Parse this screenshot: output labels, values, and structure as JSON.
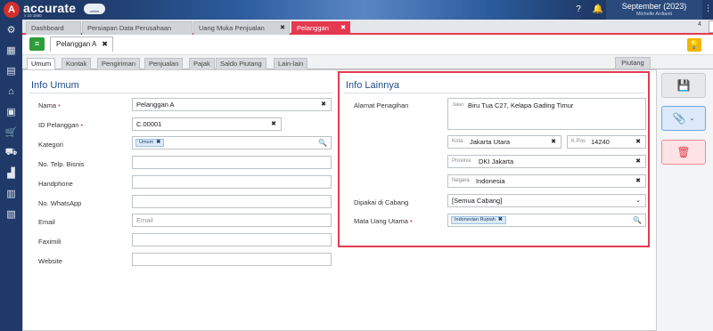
{
  "app": {
    "brand": "accurate",
    "version": "v 10.1900",
    "online_label": "online",
    "period": "September (2023)",
    "user": "Michelle Ardianti",
    "menu_glyph": "⋮"
  },
  "icons": {
    "help": "?",
    "bell": "🔔",
    "list": "≡",
    "bulb": "💡",
    "search": "🔍",
    "clear": "✖",
    "tag_remove": "✖",
    "caret": "⌄",
    "save": "💾",
    "attach": "📎",
    "trash": "🗑"
  },
  "sidebar": {
    "items": [
      {
        "icon": "gear-icon",
        "glyph": "⚙"
      },
      {
        "icon": "building-icon",
        "glyph": "▦"
      },
      {
        "icon": "book-icon",
        "glyph": "▤"
      },
      {
        "icon": "bank-icon",
        "glyph": "⌂"
      },
      {
        "icon": "box-icon",
        "glyph": "▣"
      },
      {
        "icon": "cart-icon",
        "glyph": "🛒"
      },
      {
        "icon": "truck-icon",
        "glyph": "⛟"
      },
      {
        "icon": "factory-icon",
        "glyph": "▟"
      },
      {
        "icon": "calculator-icon",
        "glyph": "▥"
      },
      {
        "icon": "report-icon",
        "glyph": "▧"
      }
    ]
  },
  "tabs": [
    {
      "label": "Dashboard",
      "closable": false
    },
    {
      "label": "Persiapan Data Perusahaan",
      "closable": false
    },
    {
      "label": "Uang Muka Penjualan",
      "closable": true
    },
    {
      "label": "Pelanggan",
      "closable": true
    }
  ],
  "tab_count": "4",
  "form_tab": {
    "label": "Pelanggan A"
  },
  "subtabs": [
    "Umum",
    "Kontak",
    "Pengiriman",
    "Penjualan",
    "Pajak",
    "Saldo Piutang",
    "Lain-lain"
  ],
  "piutang_tab": "Piutang",
  "info_umum": {
    "title": "Info Umum",
    "fields": [
      {
        "label": "Nama",
        "required": true,
        "value": "Pelanggan A",
        "clearable": true
      },
      {
        "label": "ID Pelanggan",
        "required": true,
        "value": "C.00001",
        "clearable": true
      },
      {
        "label": "Kategori",
        "required": false,
        "tag": "Umum",
        "searchable": true
      },
      {
        "label": "No. Telp. Bisnis",
        "required": false,
        "value": ""
      },
      {
        "label": "Handphone",
        "required": false,
        "value": ""
      },
      {
        "label": "No. WhatsApp",
        "required": false,
        "value": ""
      },
      {
        "label": "Email",
        "required": false,
        "value": "",
        "placeholder": "Email"
      },
      {
        "label": "Faximili",
        "required": false,
        "value": ""
      },
      {
        "label": "Website",
        "required": false,
        "value": ""
      }
    ]
  },
  "info_lainnya": {
    "title": "Info Lainnya",
    "alamat_label": "Alamat Penagihan",
    "jalan_prefix": "Jalan",
    "jalan": "Biru Tua C27, Kelapa Gading Timur",
    "kota_prefix": "Kota",
    "kota": "Jakarta Utara",
    "kpos_prefix": "K.Pos",
    "kpos": "14240",
    "provinsi_prefix": "Provinsi",
    "provinsi": "DKI Jakarta",
    "negara_prefix": "Negara",
    "negara": "Indonesia",
    "cabang_label": "Dipakai di Cabang",
    "cabang": "[Semua Cabang]",
    "mata_uang_label": "Mata Uang Utama",
    "mata_uang_required": true,
    "mata_uang": "Indonesian Rupiah"
  },
  "colors": {
    "accent": "#e53950",
    "navy": "#1f3a68",
    "title_blue": "#1f4f8a",
    "green": "#2e9c3a",
    "bulb": "#f4b400"
  }
}
